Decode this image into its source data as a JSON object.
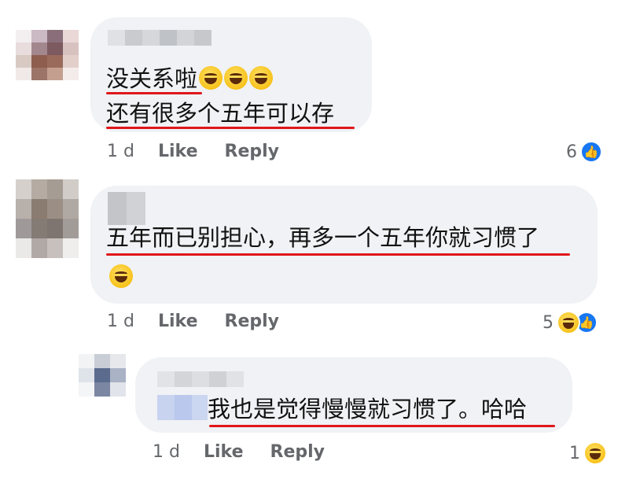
{
  "comments": [
    {
      "lines": [
        "没关系啦",
        "还有很多个五年可以存"
      ],
      "time": "1 d",
      "like_label": "Like",
      "reply_label": "Reply",
      "reaction_count": "6",
      "reactions": [
        "like-icon"
      ]
    },
    {
      "lines": [
        "五年而已别担心，再多一个五年你就习惯了"
      ],
      "time": "1 d",
      "like_label": "Like",
      "reply_label": "Reply",
      "reaction_count": "5",
      "reactions": [
        "haha-icon",
        "like-icon"
      ]
    },
    {
      "lines": [
        "我也是觉得慢慢就习惯了。哈哈"
      ],
      "time": "1 d",
      "like_label": "Like",
      "reply_label": "Reply",
      "reaction_count": "1",
      "reactions": [
        "haha-icon"
      ]
    }
  ],
  "colors": {
    "bubble": "#f0f2f5",
    "underline": "#e0161b",
    "like_blue": "#1877f2",
    "meta_text": "#65676b"
  }
}
